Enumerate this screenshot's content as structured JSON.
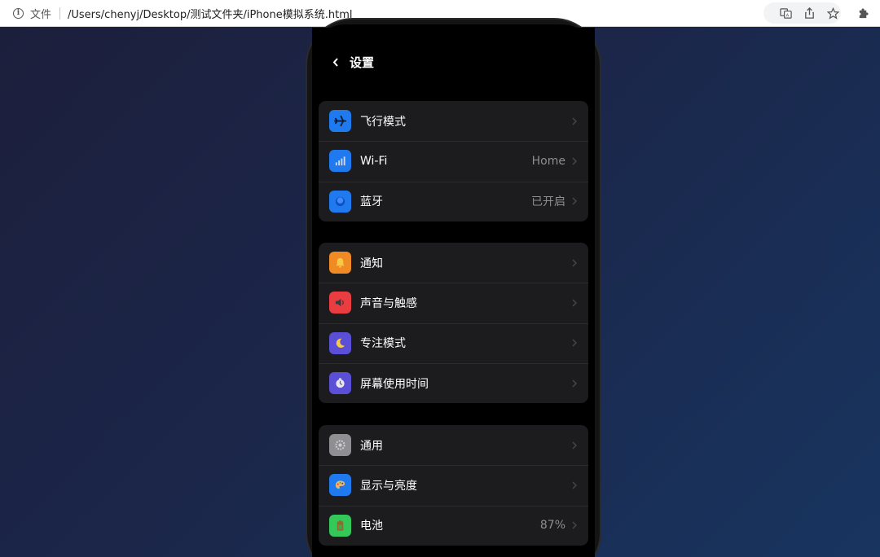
{
  "browser": {
    "file_label": "文件",
    "url": "/Users/chenyj/Desktop/测试文件夹/iPhone模拟系统.html",
    "icons": [
      "info-icon",
      "translate-icon",
      "share-icon",
      "star-icon",
      "extension-icon"
    ]
  },
  "settings": {
    "title": "设置",
    "groups": [
      {
        "items": [
          {
            "label": "飞行模式",
            "value": "",
            "icon": "airplane-icon",
            "color": "#1f7aef"
          },
          {
            "label": "Wi-Fi",
            "value": "Home",
            "icon": "wifi-icon",
            "color": "#1f7aef"
          },
          {
            "label": "蓝牙",
            "value": "已开启",
            "icon": "bluetooth-icon",
            "color": "#1f7aef"
          }
        ]
      },
      {
        "items": [
          {
            "label": "通知",
            "value": "",
            "icon": "bell-icon",
            "color": "#f08a24"
          },
          {
            "label": "声音与触感",
            "value": "",
            "icon": "speaker-icon",
            "color": "#ea3d42"
          },
          {
            "label": "专注模式",
            "value": "",
            "icon": "moon-icon",
            "color": "#5a4fd6"
          },
          {
            "label": "屏幕使用时间",
            "value": "",
            "icon": "hourglass-icon",
            "color": "#5a4fd6"
          }
        ]
      },
      {
        "items": [
          {
            "label": "通用",
            "value": "",
            "icon": "gear-icon",
            "color": "#8e8e93"
          },
          {
            "label": "显示与亮度",
            "value": "",
            "icon": "palette-icon",
            "color": "#1f7aef"
          },
          {
            "label": "电池",
            "value": "87%",
            "icon": "battery-icon",
            "color": "#34c759"
          }
        ]
      }
    ]
  }
}
